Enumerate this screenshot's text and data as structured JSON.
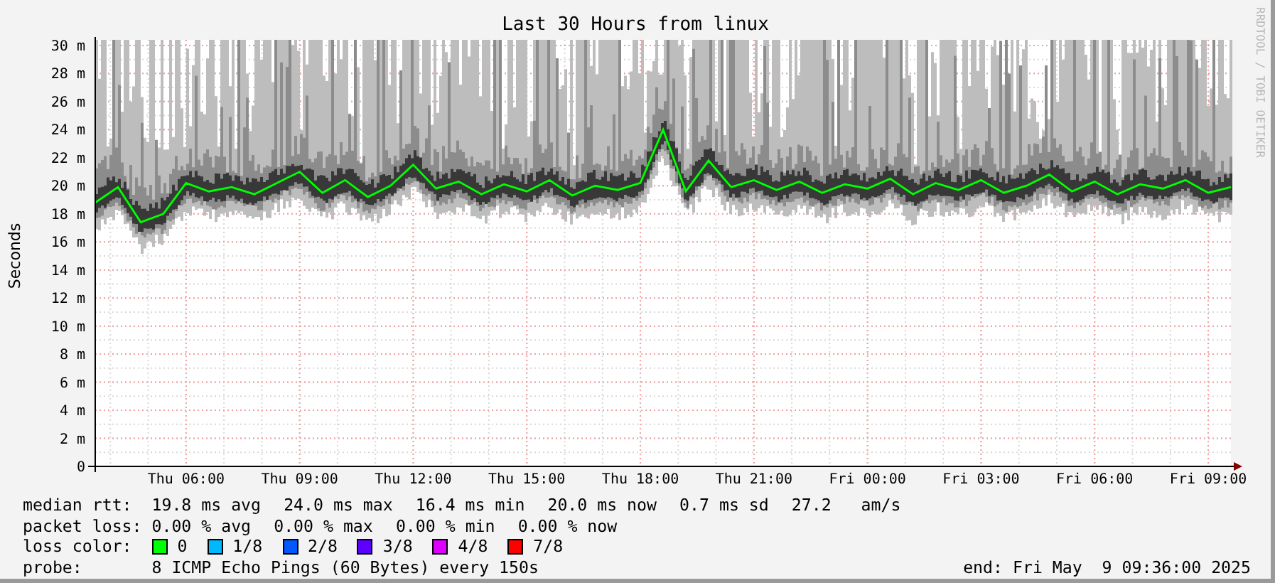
{
  "title": "Last 30 Hours from linux",
  "credit": "RRDTOOL / TOBI OETIKER",
  "chart_data": {
    "type": "line",
    "grid": true,
    "ylabel": "Seconds",
    "ylim": [
      0,
      30.4
    ],
    "categories": [
      null,
      null,
      null,
      null,
      "Thu 06:00",
      null,
      null,
      null,
      null,
      "Thu 09:00",
      null,
      null,
      null,
      null,
      "Thu 12:00",
      null,
      null,
      null,
      null,
      "Thu 15:00",
      null,
      null,
      null,
      null,
      "Thu 18:00",
      null,
      null,
      null,
      null,
      "Thu 21:00",
      null,
      null,
      null,
      null,
      "Fri 00:00",
      null,
      null,
      null,
      null,
      "Fri 03:00",
      null,
      null,
      null,
      null,
      "Fri 06:00",
      null,
      null,
      null,
      null,
      "Fri 09:00",
      null
    ],
    "series": [
      {
        "color": "#00ff00",
        "values": [
          18.8,
          19.9,
          17.4,
          18.0,
          20.2,
          19.6,
          19.9,
          19.4,
          20.2,
          21.0,
          19.5,
          20.4,
          19.2,
          20.0,
          21.5,
          19.8,
          20.3,
          19.4,
          20.1,
          19.6,
          20.4,
          19.3,
          20.0,
          19.7,
          20.2,
          24.0,
          19.6,
          21.8,
          19.9,
          20.4,
          19.7,
          20.3,
          19.5,
          20.1,
          19.8,
          20.5,
          19.4,
          20.2,
          19.7,
          20.4,
          19.5,
          20.0,
          20.8,
          19.6,
          20.3,
          19.4,
          20.1,
          19.8,
          20.4,
          19.5,
          19.9
        ]
      }
    ],
    "yticks": [
      {
        "value": 0,
        "label": "0"
      },
      {
        "value": 2,
        "label": "2 m"
      },
      {
        "value": 4,
        "label": "4 m"
      },
      {
        "value": 6,
        "label": "6 m"
      },
      {
        "value": 8,
        "label": "8 m"
      },
      {
        "value": 10,
        "label": "10 m"
      },
      {
        "value": 12,
        "label": "12 m"
      },
      {
        "value": 14,
        "label": "14 m"
      },
      {
        "value": 16,
        "label": "16 m"
      },
      {
        "value": 18,
        "label": "18 m"
      },
      {
        "value": 20,
        "label": "20 m"
      },
      {
        "value": 22,
        "label": "22 m"
      },
      {
        "value": 24,
        "label": "24 m"
      },
      {
        "value": 26,
        "label": "26 m"
      },
      {
        "value": 28,
        "label": "28 m"
      },
      {
        "value": 30,
        "label": "30 m"
      }
    ]
  },
  "legend": {
    "median_rtt": {
      "label": "median rtt:",
      "items": [
        "19.8 ms avg",
        "24.0 ms max",
        "16.4 ms min",
        "20.0 ms now",
        "0.7 ms sd",
        "27.2   am/s"
      ]
    },
    "packet_loss": {
      "label": "packet loss:",
      "items": [
        "0.00 % avg",
        "0.00 % max",
        "0.00 % min",
        "0.00 % now"
      ]
    },
    "loss_color": {
      "label": "loss color:",
      "items": [
        {
          "label": "0",
          "color": "#00ff00"
        },
        {
          "label": "1/8",
          "color": "#00b8ff"
        },
        {
          "label": "2/8",
          "color": "#0059ff"
        },
        {
          "label": "3/8",
          "color": "#5e00ff"
        },
        {
          "label": "4/8",
          "color": "#dd00ff"
        },
        {
          "label": "7/8",
          "color": "#ff0000"
        }
      ]
    },
    "probe": {
      "label": "probe:",
      "value": "8 ICMP Echo Pings (60 Bytes) every 150s"
    },
    "end": "end: Fri May  9 09:36:00 2025"
  }
}
